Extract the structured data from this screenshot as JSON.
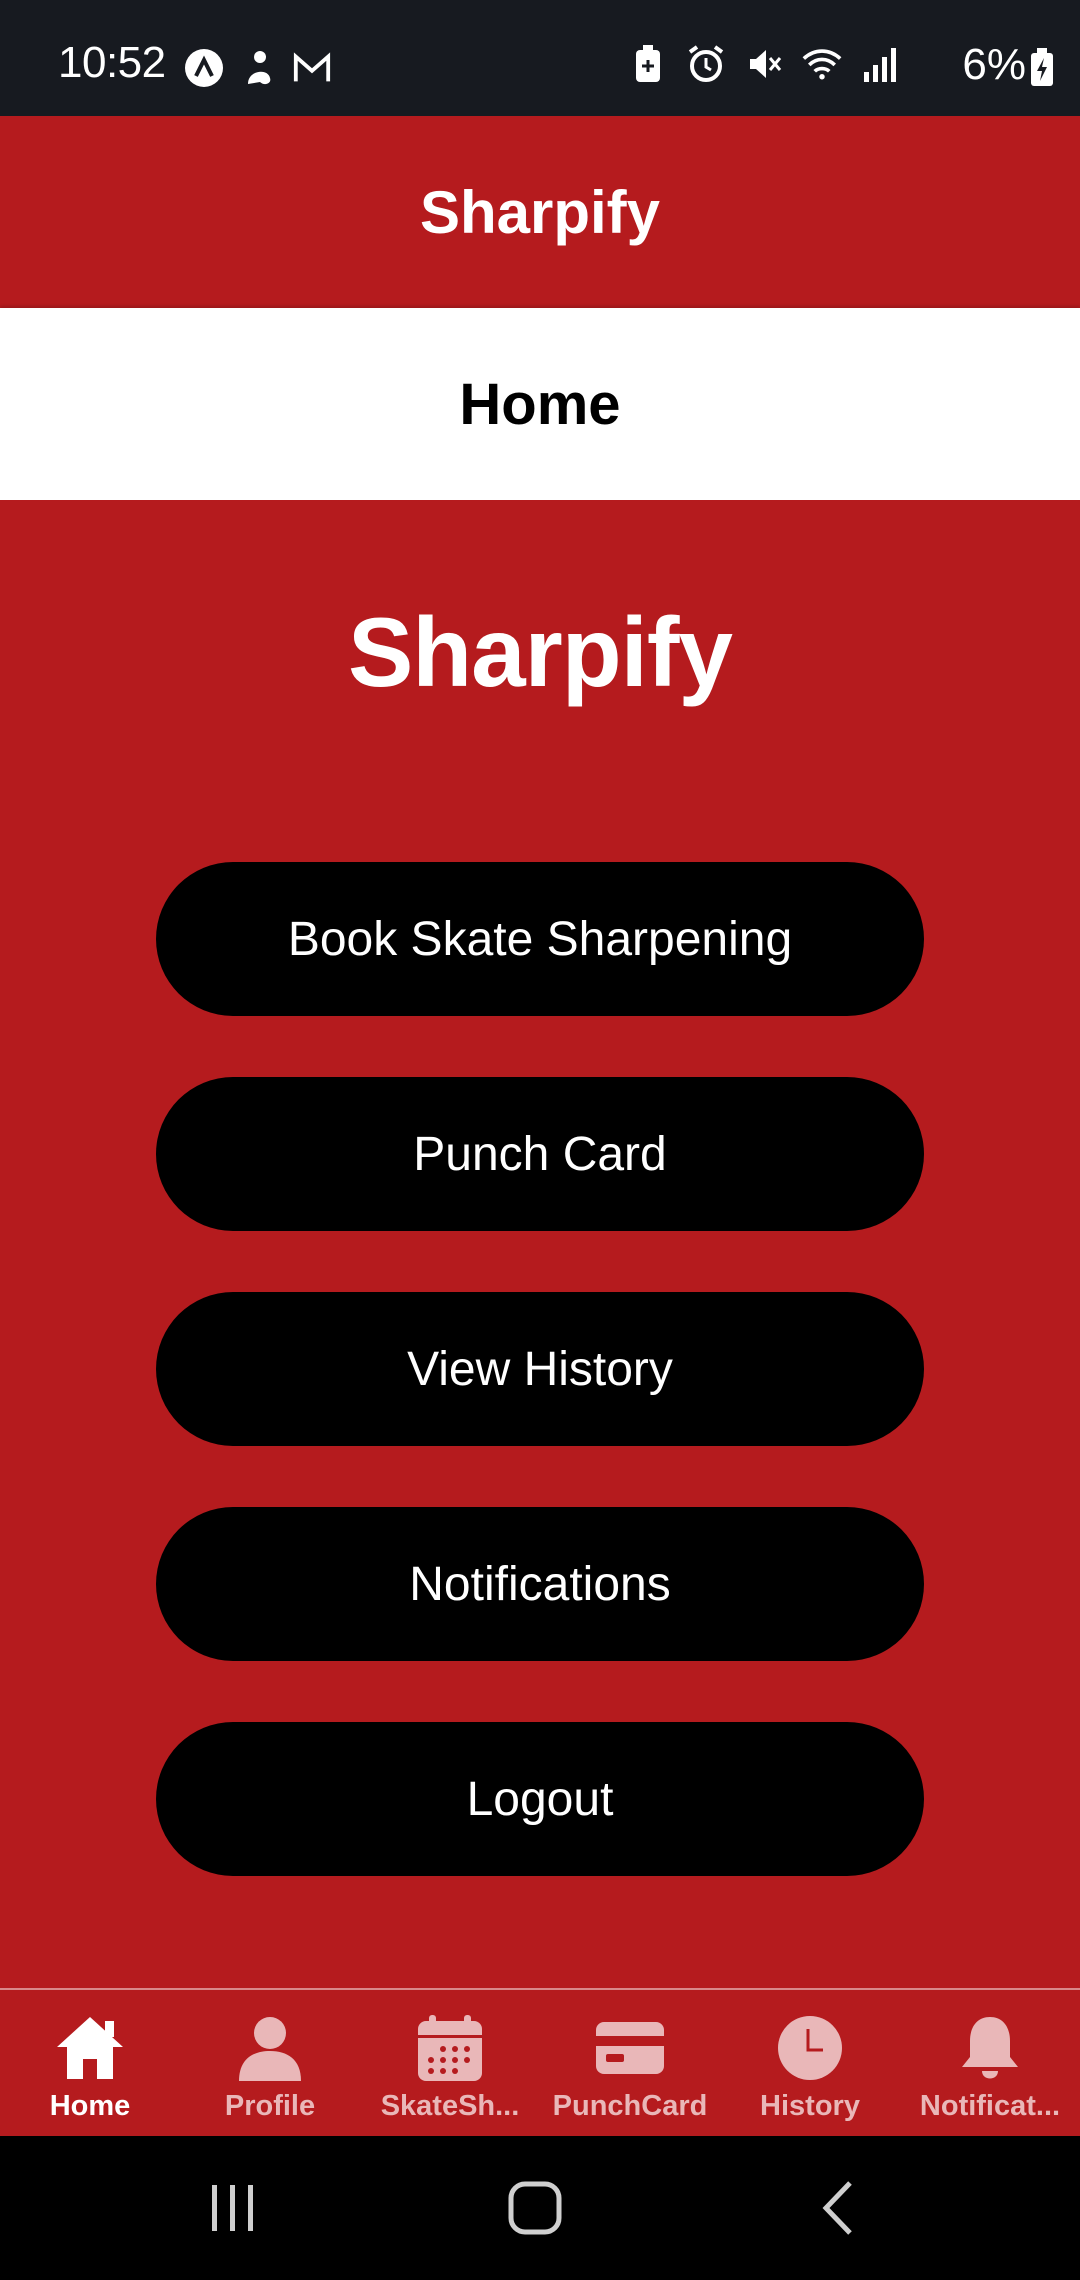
{
  "status_bar": {
    "time": "10:52",
    "battery_percent": "6%",
    "left_icons": [
      "a-circle-icon",
      "figure-icon",
      "gmail-icon"
    ],
    "right_icons": [
      "battery-saver-icon",
      "alarm-icon",
      "mute-icon",
      "wifi-icon",
      "signal-icon",
      "battery-charging-icon"
    ]
  },
  "app_header": {
    "title": "Sharpify"
  },
  "page_header": {
    "title": "Home"
  },
  "main": {
    "hero_title": "Sharpify",
    "buttons": [
      {
        "label": "Book Skate Sharpening"
      },
      {
        "label": "Punch Card"
      },
      {
        "label": "View History"
      },
      {
        "label": "Notifications"
      },
      {
        "label": "Logout"
      }
    ]
  },
  "bottom_nav": {
    "items": [
      {
        "label": "Home",
        "icon": "home-icon",
        "active": true
      },
      {
        "label": "Profile",
        "icon": "person-icon",
        "active": false
      },
      {
        "label": "SkateSh...",
        "icon": "calendar-icon",
        "active": false
      },
      {
        "label": "PunchCard",
        "icon": "card-icon",
        "active": false
      },
      {
        "label": "History",
        "icon": "clock-icon",
        "active": false
      },
      {
        "label": "Notificat...",
        "icon": "bell-icon",
        "active": false
      }
    ]
  },
  "colors": {
    "brand_red": "#b51b1e",
    "status_bar_bg": "#171a20",
    "button_bg": "#000000",
    "nav_inactive": "#e9b7b8"
  }
}
